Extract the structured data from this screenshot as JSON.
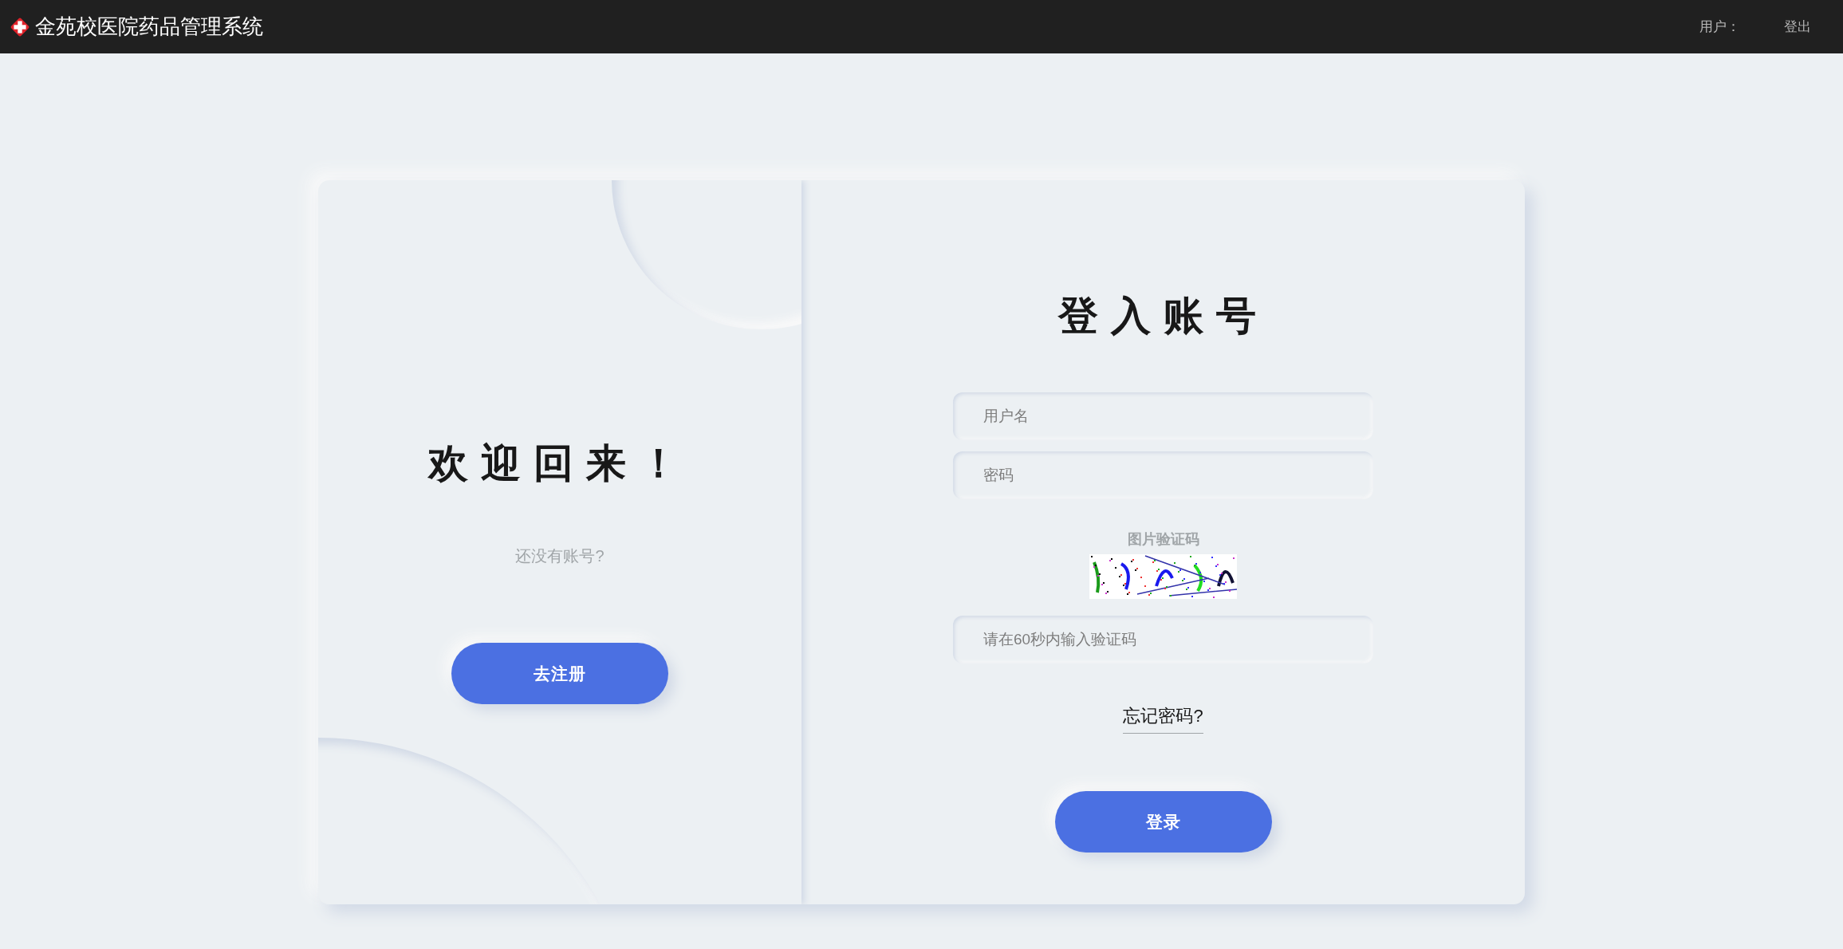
{
  "header": {
    "title": "金苑校医院药品管理系统",
    "user_label": "用户：",
    "logout": "登出"
  },
  "welcome_panel": {
    "title": "欢迎回来！",
    "prompt": "还没有账号?",
    "register_button": "去注册"
  },
  "login_form": {
    "title": "登入账号",
    "fields": [
      {
        "placeholder": "用户名"
      },
      {
        "placeholder": "密码"
      }
    ],
    "captcha_label": "图片验证码",
    "captcha_field": {
      "placeholder": "请在60秒内输入验证码"
    },
    "forgot_link": "忘记密码?",
    "login_button": "登录"
  }
}
